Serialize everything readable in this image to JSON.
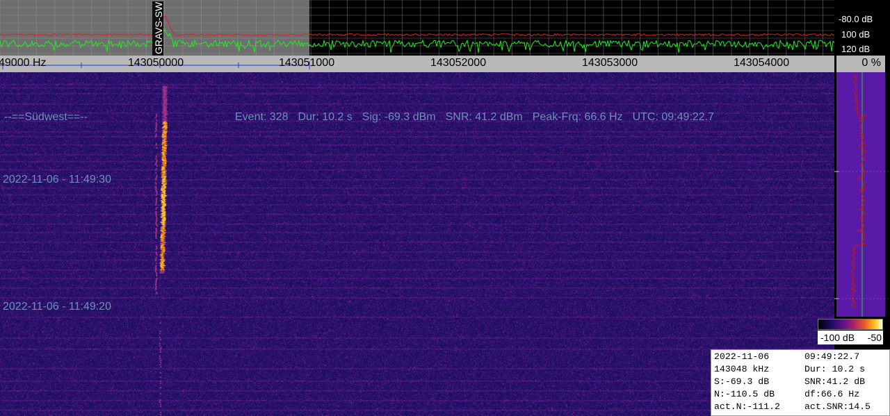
{
  "spectrum": {
    "db_labels": [
      "-80.0 dB",
      "100 dB",
      "120 dB"
    ],
    "marker_label": "GRAVS-SW"
  },
  "freq_axis": {
    "labels": [
      "49000 Hz",
      "143050000",
      "143051000",
      "143052000",
      "143053000",
      "143054000"
    ],
    "percent": "0 %"
  },
  "waterfall": {
    "station": "--==Südwest==--",
    "event": {
      "event": "Event: 328",
      "dur": "Dur: 10.2 s",
      "sig": "Sig: -69.3 dBm",
      "snr": "SNR: 41.2 dBm",
      "peak": "Peak-Frq: 66.6 Hz",
      "utc": "UTC: 09:49:22.7"
    },
    "timestamps": [
      "2022-11-06 - 11:49:30",
      "2022-11-06 - 11:49:20"
    ]
  },
  "colorbar": {
    "min_label": "-100 dB",
    "max_label": "-50"
  },
  "info": {
    "rows": [
      [
        "2022-11-06",
        "09:49:22.7"
      ],
      [
        "143048 kHz",
        "Dur: 10.2 s"
      ],
      [
        "S:-69.3 dB",
        "SNR:41.2 dB"
      ],
      [
        "N:-110.5 dB",
        "df:66.6 Hz"
      ],
      [
        "act.N:-111.2",
        "act.SNR:14.5"
      ]
    ]
  },
  "colors": {
    "spectrum_trace": "#22ee22",
    "peak_trace": "#e02020",
    "waterfall_bg": "#1d1668",
    "meteor": "#ffb020"
  }
}
